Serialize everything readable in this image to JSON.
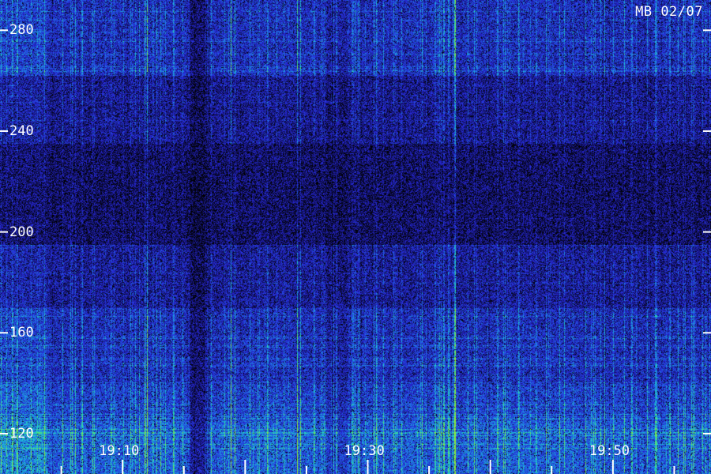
{
  "chart_data": {
    "type": "heatmap",
    "title": "MB 02/07",
    "xlabel": "",
    "ylabel": "",
    "x_tick_labels": [
      "19:10",
      "19:30",
      "19:50"
    ],
    "x_tick_minutes": [
      10,
      30,
      50
    ],
    "x_start_minute": 0,
    "x_end_minute": 58,
    "y_ticks": [
      120,
      160,
      200,
      240,
      280
    ],
    "ylim": [
      104,
      292
    ],
    "grid": false,
    "colormap": [
      "#000000",
      "#1a1a6e",
      "#2a2adf",
      "#1e7fe0",
      "#20d0d0",
      "#40e08a",
      "#80e040"
    ]
  }
}
